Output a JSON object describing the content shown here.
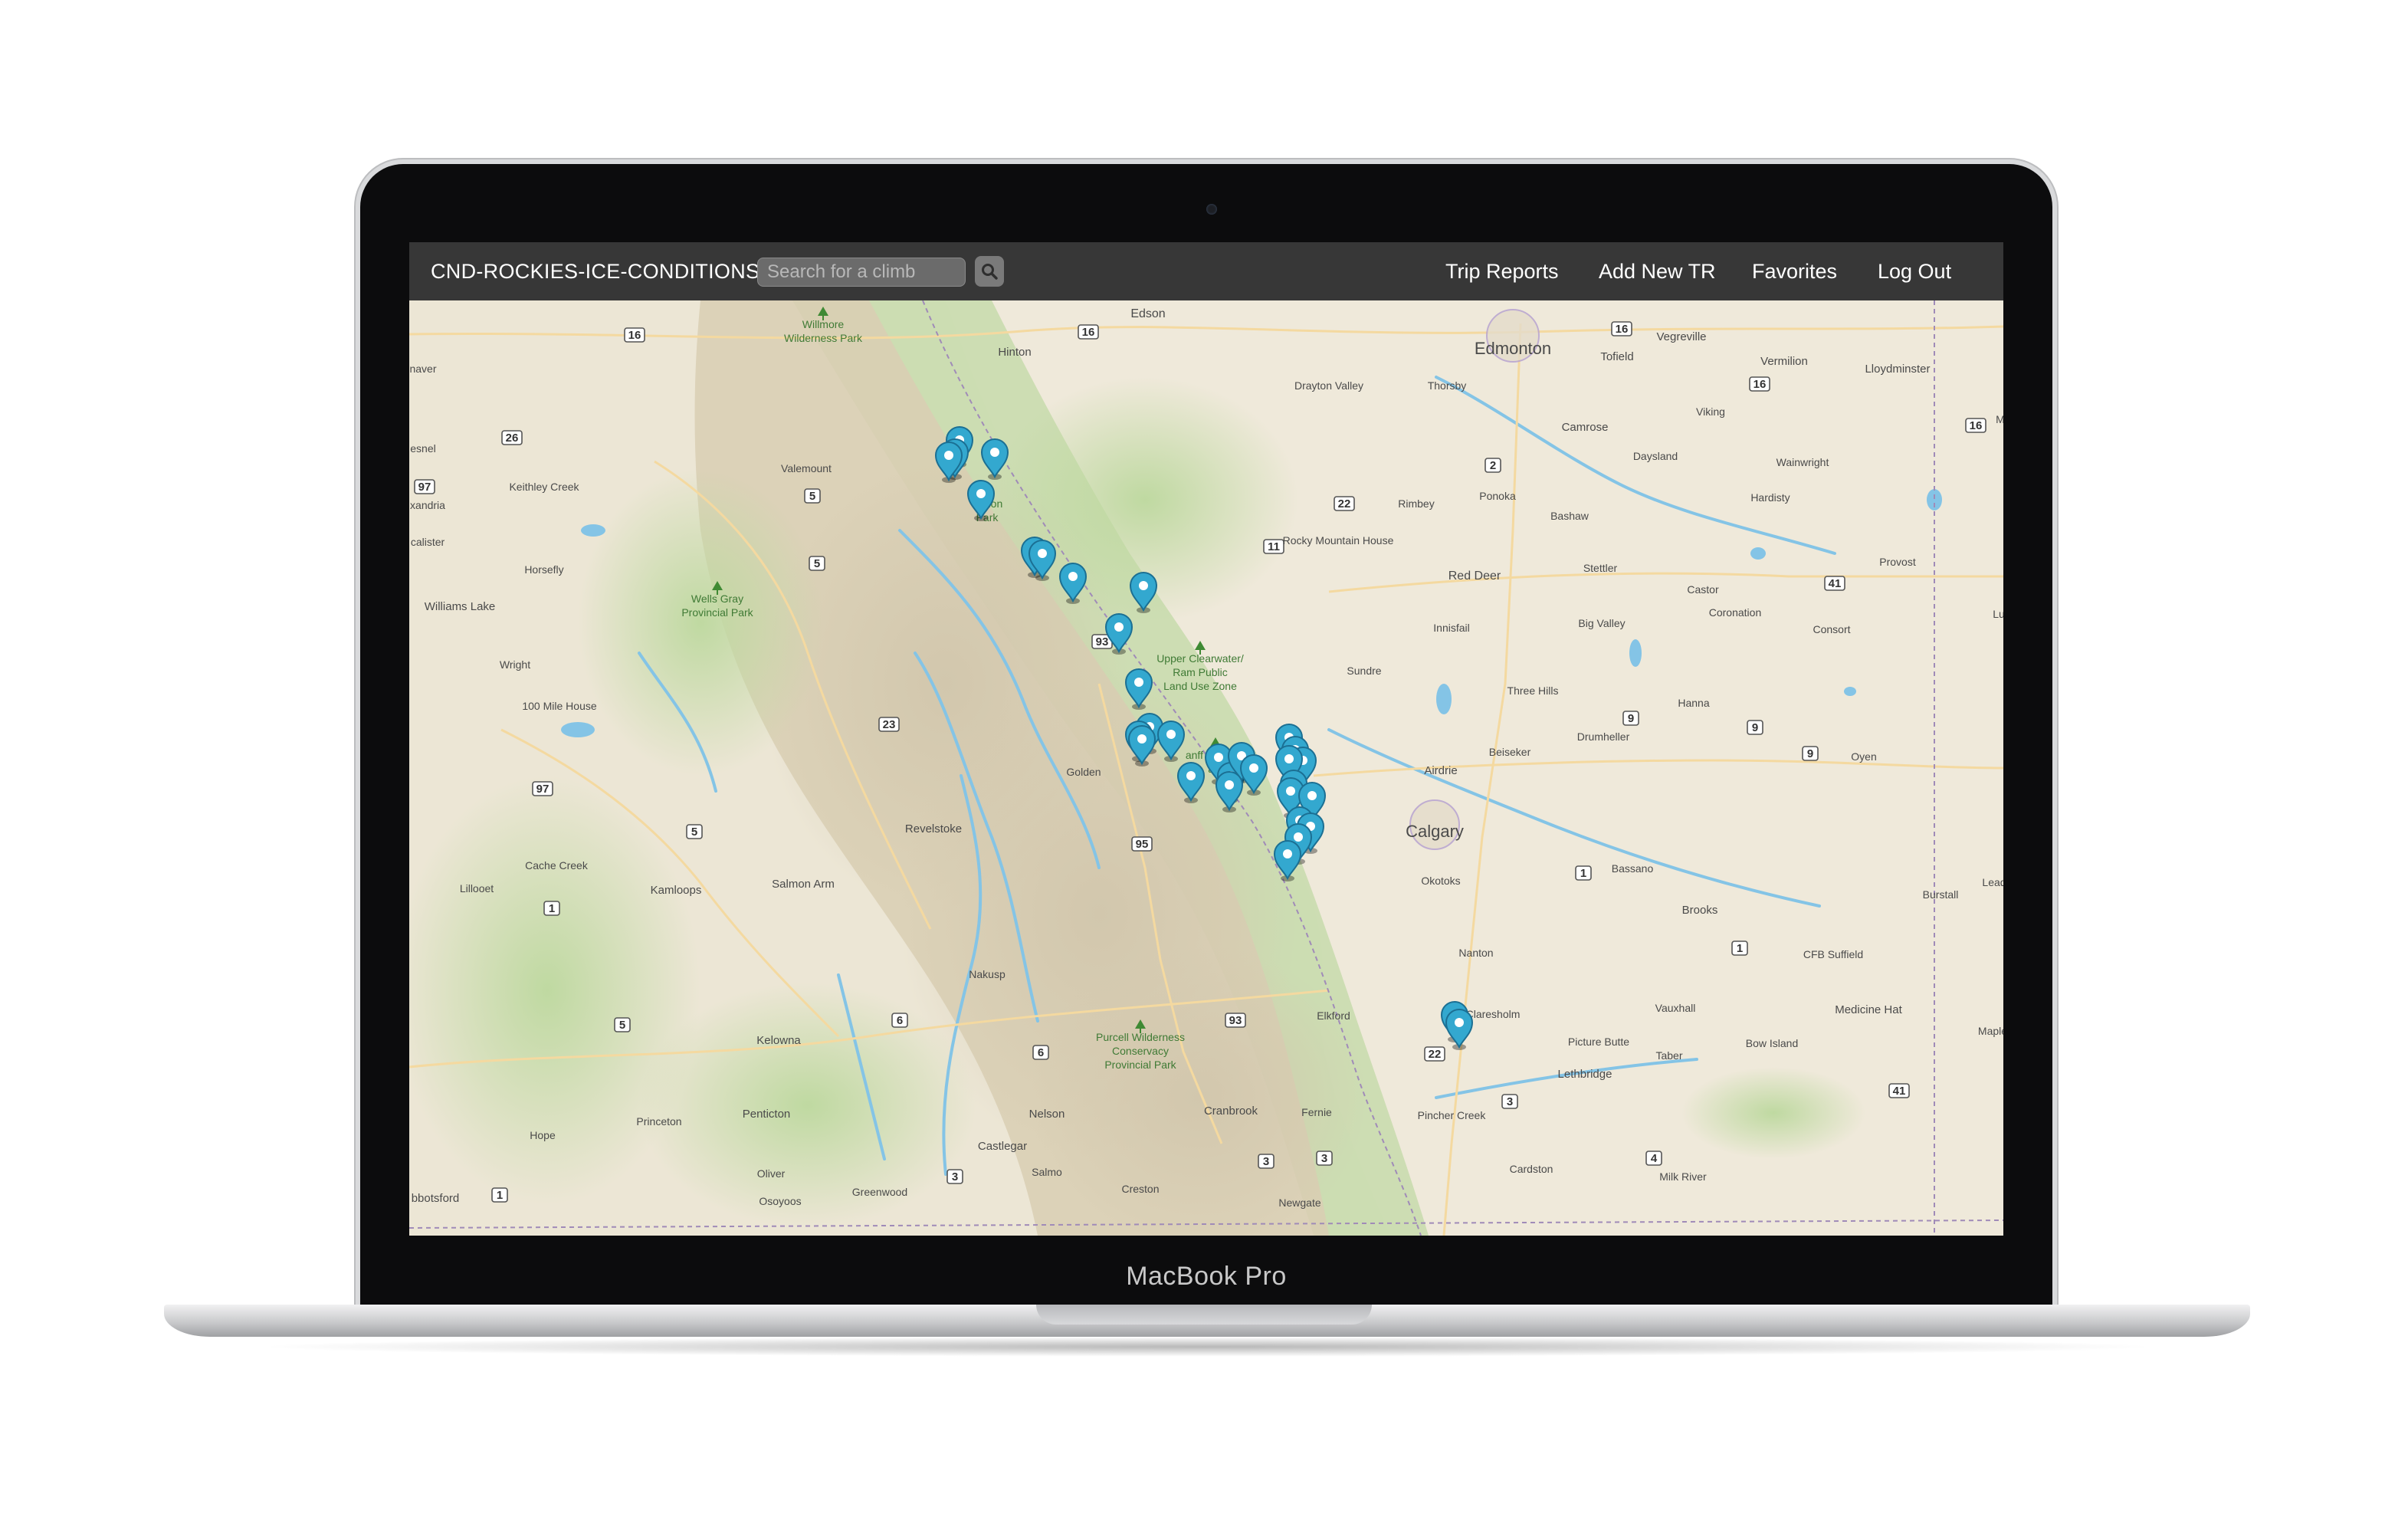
{
  "device": {
    "brand_label": "MacBook Pro"
  },
  "navbar": {
    "brand": "CND-ROCKIES-ICE-CONDITIONS",
    "search_placeholder": "Search for a climb",
    "links": [
      "Trip Reports",
      "Add New TR",
      "Favorites",
      "Log Out"
    ]
  },
  "map": {
    "places": {
      "edmonton": "Edmonton",
      "calgary": "Calgary",
      "edson": "Edson",
      "hinton": "Hinton",
      "vegreville": "Vegreville",
      "tofield": "Tofield",
      "vermilion": "Vermilion",
      "lloydminster": "Lloydminster",
      "drayton_valley": "Drayton Valley",
      "thorsby": "Thorsby",
      "camrose": "Camrose",
      "viking": "Viking",
      "daysland": "Daysland",
      "wainwright": "Wainwright",
      "hardisty": "Hardisty",
      "ponoka": "Ponoka",
      "rimbey": "Rimbey",
      "bashaw": "Bashaw",
      "rocky_mountain_house": "Rocky Mountain House",
      "red_deer": "Red Deer",
      "stettler": "Stettler",
      "castor": "Castor",
      "provost": "Provost",
      "coronation": "Coronation",
      "consort": "Consort",
      "innisfail": "Innisfail",
      "big_valley": "Big Valley",
      "sundre": "Sundre",
      "three_hills": "Three Hills",
      "hanna": "Hanna",
      "drumheller": "Drumheller",
      "beiseker": "Beiseker",
      "oyen": "Oyen",
      "airdrie": "Airdrie",
      "okotoks": "Okotoks",
      "bassano": "Bassano",
      "burstall": "Burstall",
      "brooks": "Brooks",
      "cfb_suffield": "CFB Suffield",
      "nanton": "Nanton",
      "claresholm": "Claresholm",
      "vauxhall": "Vauxhall",
      "medicine_hat": "Medicine Hat",
      "picture_butte": "Picture Butte",
      "taber": "Taber",
      "bow_island": "Bow Island",
      "lethbridge": "Lethbridge",
      "pincher_creek": "Pincher Creek",
      "cardston": "Cardston",
      "milk_river": "Milk River",
      "valemount": "Valemount",
      "keithley_creek": "Keithley Creek",
      "horsefly": "Horsefly",
      "williams_lake": "Williams Lake",
      "wright": "Wright",
      "100_mile_house": "100 Mile House",
      "golden": "Golden",
      "revelstoke": "Revelstoke",
      "cache_creek": "Cache Creek",
      "kamloops": "Kamloops",
      "salmon_arm": "Salmon Arm",
      "lillooet": "Lillooet",
      "nakusp": "Nakusp",
      "elkford": "Elkford",
      "kelowna": "Kelowna",
      "penticton": "Penticton",
      "princeton": "Princeton",
      "hope": "Hope",
      "abbotsford": "bbotsford",
      "oliver": "Oliver",
      "osoyoos": "Osoyoos",
      "greenwood": "Greenwood",
      "castlegar": "Castlegar",
      "nelson": "Nelson",
      "salmo": "Salmo",
      "creston": "Creston",
      "cranbrook": "Cranbrook",
      "fernie": "Fernie",
      "newgate": "Newgate",
      "naver": "naver",
      "esnel": "esnel",
      "xandria": "xandria",
      "calister": "calister",
      "lead": "Lead",
      "maple": "Maple",
      "lu": "Lu",
      "m": "M"
    },
    "parks": {
      "willmore": [
        "Willmore",
        "Wilderness Park"
      ],
      "jasper": [
        "Nation",
        "Park"
      ],
      "wells_gray": [
        "Wells Gray",
        "Provincial Park"
      ],
      "clearwater": [
        "Upper Clearwater/",
        "Ram Public",
        "Land Use Zone"
      ],
      "banff": [
        "anff National",
        "ark"
      ],
      "purcell": [
        "Purcell Wilderness",
        "Conservacy",
        "Provincial Park"
      ]
    },
    "highways": [
      "16",
      "16",
      "16",
      "16",
      "16",
      "26",
      "97",
      "5",
      "5",
      "2",
      "22",
      "11",
      "41",
      "93",
      "23",
      "9",
      "9",
      "9",
      "97",
      "5",
      "95",
      "1",
      "1",
      "1",
      "6",
      "6",
      "93",
      "5",
      "22",
      "3",
      "3",
      "3",
      "3",
      "4",
      "41",
      "1"
    ],
    "marker_count": 34
  }
}
